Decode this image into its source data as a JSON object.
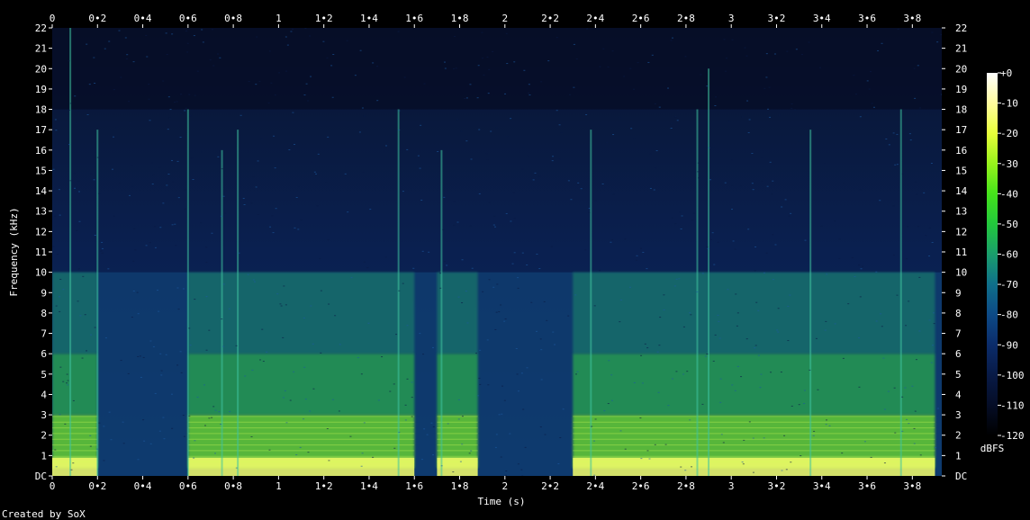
{
  "chart_data": {
    "type": "heatmap",
    "subtype": "spectrogram",
    "xlabel": "Time (s)",
    "ylabel": "Frequency (kHz)",
    "xlim": [
      0,
      3.93
    ],
    "ylim": [
      0,
      22
    ],
    "x_ticks": [
      "0",
      "0•2",
      "0•4",
      "0•6",
      "0•8",
      "1",
      "1•2",
      "1•4",
      "1•6",
      "1•8",
      "2",
      "2•2",
      "2•4",
      "2•6",
      "2•8",
      "3",
      "3•2",
      "3•4",
      "3•6",
      "3•8"
    ],
    "x_tick_values": [
      0,
      0.2,
      0.4,
      0.6,
      0.8,
      1.0,
      1.2,
      1.4,
      1.6,
      1.8,
      2.0,
      2.2,
      2.4,
      2.6,
      2.8,
      3.0,
      3.2,
      3.4,
      3.6,
      3.8
    ],
    "y_ticks": [
      "DC",
      "1",
      "2",
      "3",
      "4",
      "5",
      "6",
      "7",
      "8",
      "9",
      "10",
      "11",
      "12",
      "13",
      "14",
      "15",
      "16",
      "17",
      "18",
      "19",
      "20",
      "21",
      "22"
    ],
    "y_tick_values": [
      0,
      1,
      2,
      3,
      4,
      5,
      6,
      7,
      8,
      9,
      10,
      11,
      12,
      13,
      14,
      15,
      16,
      17,
      18,
      19,
      20,
      21,
      22
    ],
    "colorbar": {
      "label": "dBFS",
      "ticks": [
        "+0",
        "-10",
        "-20",
        "-30",
        "-40",
        "-50",
        "-60",
        "-70",
        "-80",
        "-90",
        "-100",
        "-110",
        "-120"
      ],
      "tick_values": [
        0,
        -10,
        -20,
        -30,
        -40,
        -50,
        -60,
        -70,
        -80,
        -90,
        -100,
        -110,
        -120
      ],
      "range": [
        -120,
        0
      ],
      "colormap": [
        "#ffffff",
        "#fffb9e",
        "#e8ff3a",
        "#98f21c",
        "#45e31b",
        "#22c83c",
        "#1a9e6c",
        "#0f6f8a",
        "#0d4a86",
        "#0b2c6a",
        "#081a46",
        "#050d26",
        "#000000"
      ]
    },
    "speech_segments_s": [
      [
        0.0,
        0.2
      ],
      [
        0.6,
        1.6
      ],
      [
        1.7,
        1.88
      ],
      [
        2.3,
        3.9
      ]
    ],
    "loud_band_upper_khz": 10,
    "footer": "Created by SoX"
  }
}
